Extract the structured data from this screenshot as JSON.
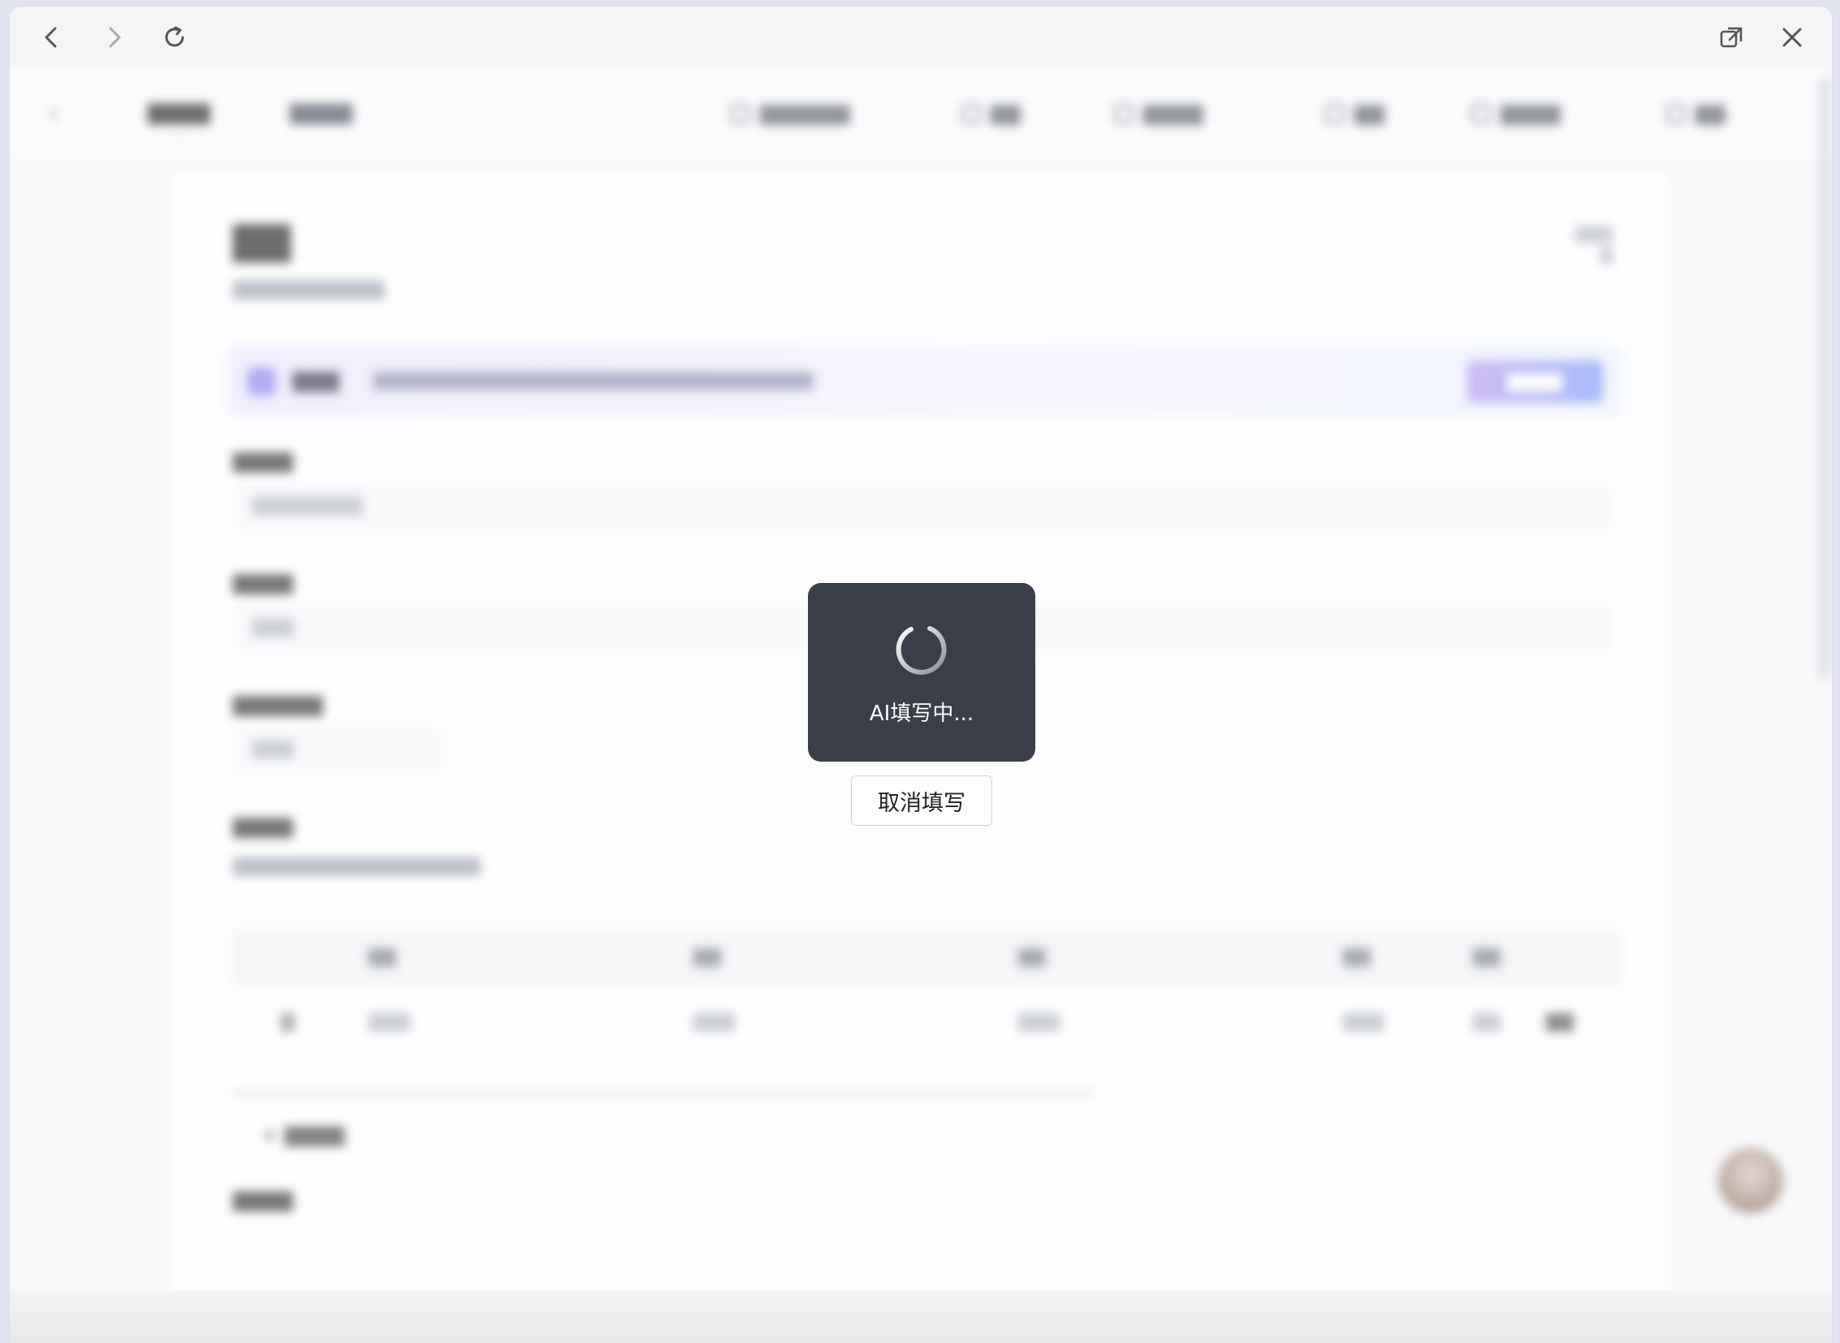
{
  "browser": {
    "icons": [
      "back-icon",
      "forward-icon",
      "refresh-icon",
      "open-external-icon",
      "close-icon"
    ]
  },
  "loading": {
    "text": "AI填写中...",
    "cancel_label": "取消填写"
  },
  "colors": {
    "overlay_box": "#3a3e48",
    "page_bg": "#f7f7f9",
    "ai_accent": "#8c86f2"
  }
}
